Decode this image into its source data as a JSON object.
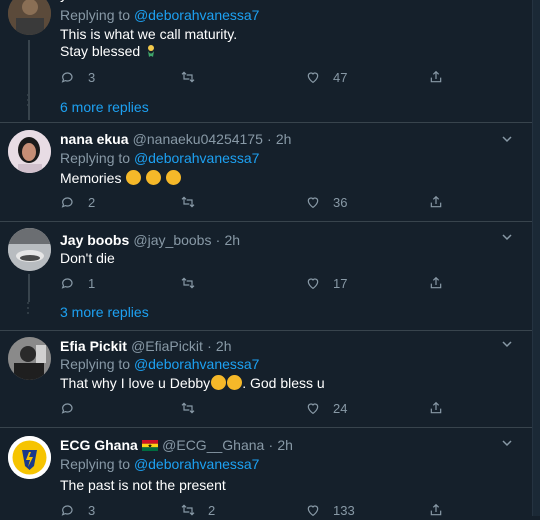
{
  "top_tweet": {
    "partial_header": "y",
    "replying_prefix": "Replying to",
    "replying_mention": "@deborahvanessa7",
    "lines": [
      "This is what we call maturity.",
      "Stay blessed"
    ],
    "counts": {
      "reply": "3",
      "retweet": "",
      "like": "47"
    }
  },
  "more_replies_1": "6 more replies",
  "tweets": [
    {
      "name": "nana ekua",
      "handle": "@nanaeku04254175",
      "sep": "·",
      "time": "2h",
      "replying_prefix": "Replying to",
      "replying_mention": "@deborahvanessa7",
      "text": "Memories",
      "counts": {
        "reply": "2",
        "retweet": "",
        "like": "36"
      }
    },
    {
      "name": "Jay boobs",
      "handle": "@jay_boobs",
      "sep": "·",
      "time": "2h",
      "text": "Don't die",
      "counts": {
        "reply": "1",
        "retweet": "",
        "like": "17"
      }
    },
    {
      "name": "Efia Pickit",
      "handle": "@EfiaPickit",
      "sep": "·",
      "time": "2h",
      "replying_prefix": "Replying to",
      "replying_mention": "@deborahvanessa7",
      "text_before": "That why I love u Debby",
      "text_after": ". God bless u",
      "counts": {
        "reply": "",
        "retweet": "",
        "like": "24"
      }
    },
    {
      "name": "ECG Ghana",
      "handle": "@ECG__Ghana",
      "sep": "·",
      "time": "2h",
      "replying_prefix": "Replying to",
      "replying_mention": "@deborahvanessa7",
      "text": "The past is not the present",
      "counts": {
        "reply": "3",
        "retweet": "2",
        "like": "133"
      }
    }
  ],
  "more_replies_2": "3 more replies",
  "colors": {
    "bg": "#15202b",
    "accent": "#1da1f2",
    "muted": "#8899a6",
    "border": "#38444d"
  }
}
